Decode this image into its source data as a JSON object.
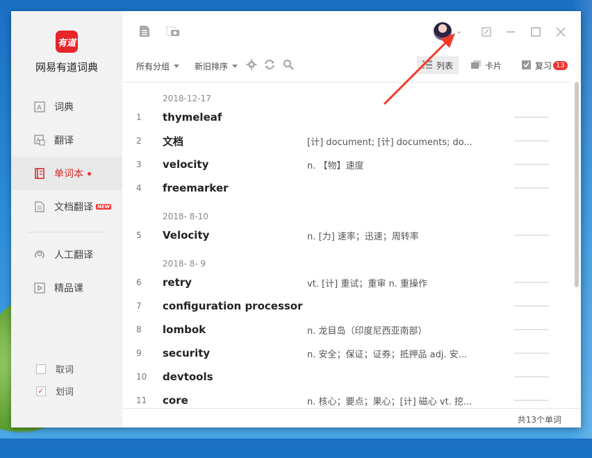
{
  "app": {
    "logo_text": "有道",
    "name": "网易有道词典"
  },
  "sidebar": {
    "items": [
      {
        "label": "词典",
        "icon": "dictionary-icon"
      },
      {
        "label": "翻译",
        "icon": "translate-icon"
      },
      {
        "label": "单词本",
        "icon": "wordbook-icon",
        "active": true
      },
      {
        "label": "文档翻译",
        "icon": "document-icon",
        "badge": "NEW"
      },
      {
        "label": "人工翻译",
        "icon": "human-translate-icon"
      },
      {
        "label": "精品课",
        "icon": "course-icon"
      }
    ],
    "options": [
      {
        "label": "取词",
        "checked": false
      },
      {
        "label": "划词",
        "checked": true
      }
    ]
  },
  "toolbar": {
    "group_filter": "所有分组",
    "sort": "新旧排序",
    "view_list": "列表",
    "view_card": "卡片",
    "review": "复习",
    "review_count": "13"
  },
  "wordlist": {
    "groups": [
      {
        "date": "2018-12-17"
      },
      {
        "date": "2018- 8-10"
      },
      {
        "date": "2018- 8- 9"
      }
    ],
    "rows": [
      {
        "n": "1",
        "word": "thymeleaf",
        "def": ""
      },
      {
        "n": "2",
        "word": "文档",
        "def": "[计] document;  [计] documents;  do..."
      },
      {
        "n": "3",
        "word": "velocity",
        "def": "n. 【物】速度"
      },
      {
        "n": "4",
        "word": "freemarker",
        "def": ""
      },
      {
        "n": "5",
        "word": "Velocity",
        "def": "n. [力] 速率；迅速；周转率"
      },
      {
        "n": "6",
        "word": "retry",
        "def": "vt. [计] 重试；重审  n. 重操作"
      },
      {
        "n": "7",
        "word": "configuration processor",
        "def": ""
      },
      {
        "n": "8",
        "word": "lombok",
        "def": "n. 龙目岛（印度尼西亚南部）"
      },
      {
        "n": "9",
        "word": "security",
        "def": "n. 安全；保证；证券；抵押品  adj. 安..."
      },
      {
        "n": "10",
        "word": "devtools",
        "def": ""
      },
      {
        "n": "11",
        "word": "core",
        "def": "n. 核心；要点；果心；[计] 磁心  vt. 挖..."
      }
    ]
  },
  "footer": {
    "total": "共13个单词"
  },
  "colors": {
    "accent": "#e6262a",
    "badge": "#ee3333"
  }
}
